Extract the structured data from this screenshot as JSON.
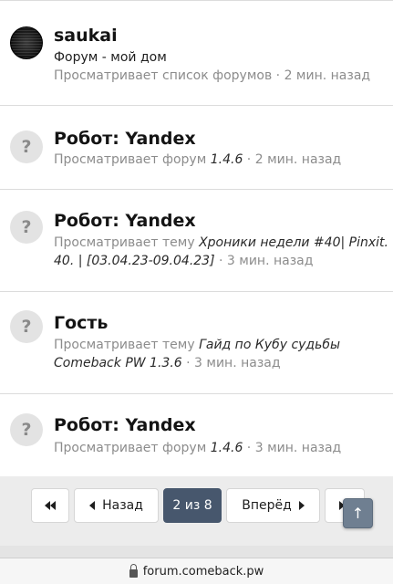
{
  "members": [
    {
      "avatar": "user-avatar",
      "name": "saukai",
      "status": "Форум - мой дом",
      "activity": "Просматривает список форумов",
      "target": "",
      "target2": "",
      "time": "2 мин. назад"
    },
    {
      "avatar": "?",
      "name": "Робот: Yandex",
      "activity": "Просматривает форум",
      "target": "1.4.6",
      "time": "2 мин. назад"
    },
    {
      "avatar": "?",
      "name": "Робот: Yandex",
      "activity": "Просматривает тему",
      "target": "Хроники недели #40| Pinxit.",
      "target2": "40. | [03.04.23-09.04.23]",
      "time": "3 мин. назад"
    },
    {
      "avatar": "?",
      "name": "Гость",
      "activity": "Просматривает тему",
      "target": "Гайд по Кубу судьбы",
      "target2": "Comeback PW 1.3.6",
      "time": "3 мин. назад"
    },
    {
      "avatar": "?",
      "name": "Робот: Yandex",
      "activity": "Просматривает форум",
      "target": "1.4.6",
      "time": "3 мин. назад"
    }
  ],
  "separator": " · ",
  "pagination": {
    "prev_label": "Назад",
    "current_label": "2 из 8",
    "next_label": "Вперёд"
  },
  "browser": {
    "url": "forum.comeback.pw"
  },
  "colors": {
    "active_page": "#47576d",
    "muted_text": "#8c8c8c",
    "scroll_top_button": "#6f7f91"
  }
}
